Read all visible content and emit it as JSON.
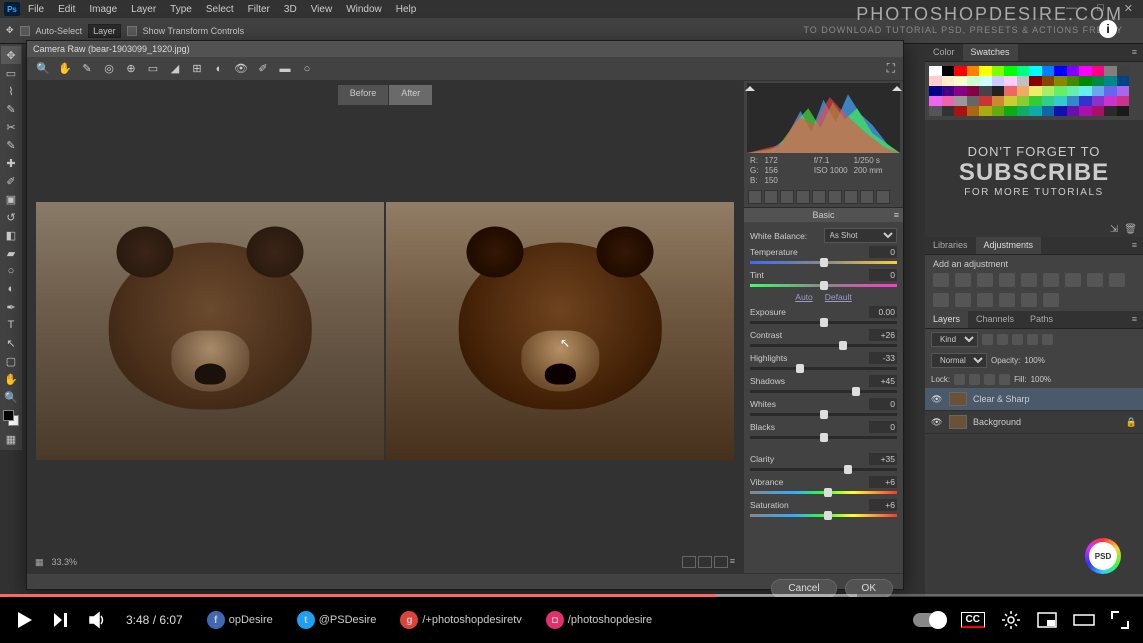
{
  "menu": [
    "File",
    "Edit",
    "Image",
    "Layer",
    "Type",
    "Select",
    "Filter",
    "3D",
    "View",
    "Window",
    "Help"
  ],
  "options": {
    "autoSelect": "Auto-Select",
    "layer": "Layer",
    "showTransform": "Show Transform Controls"
  },
  "watermark": {
    "line1": "PHOTOSHOPDESIRE.COM",
    "line2": "TO DOWNLOAD TUTORIAL PSD, PRESETS & ACTIONS FREELY"
  },
  "cr": {
    "title": "Camera Raw (bear-1903099_1920.jpg)",
    "tabs": {
      "before": "Before",
      "after": "After"
    },
    "zoom": "33.3%",
    "readout": {
      "r": "172",
      "g": "156",
      "b": "150",
      "fstop": "f/7.1",
      "shutter": "1/250 s",
      "iso": "ISO 1000",
      "lens": "200 mm"
    },
    "panel": "Basic",
    "wb": {
      "label": "White Balance:",
      "value": "As Shot"
    },
    "auto": "Auto",
    "default": "Default",
    "sliders": {
      "temperature": {
        "label": "Temperature",
        "value": "0",
        "pos": 50
      },
      "tint": {
        "label": "Tint",
        "value": "0",
        "pos": 50
      },
      "exposure": {
        "label": "Exposure",
        "value": "0.00",
        "pos": 50
      },
      "contrast": {
        "label": "Contrast",
        "value": "+26",
        "pos": 63
      },
      "highlights": {
        "label": "Highlights",
        "value": "-33",
        "pos": 34
      },
      "shadows": {
        "label": "Shadows",
        "value": "+45",
        "pos": 72
      },
      "whites": {
        "label": "Whites",
        "value": "0",
        "pos": 50
      },
      "blacks": {
        "label": "Blacks",
        "value": "0",
        "pos": 50
      },
      "clarity": {
        "label": "Clarity",
        "value": "+35",
        "pos": 67
      },
      "vibrance": {
        "label": "Vibrance",
        "value": "+6",
        "pos": 53
      },
      "saturation": {
        "label": "Saturation",
        "value": "+6",
        "pos": 53
      }
    },
    "buttons": {
      "cancel": "Cancel",
      "ok": "OK"
    }
  },
  "panels": {
    "color": "Color",
    "swatches": "Swatches",
    "libraries": "Libraries",
    "adjustments": "Adjustments",
    "addAdj": "Add an adjustment",
    "layers": "Layers",
    "channels": "Channels",
    "paths": "Paths",
    "kind": "Kind",
    "normal": "Normal",
    "opacity": "Opacity:",
    "opVal": "100%",
    "lock": "Lock:",
    "fill": "Fill:",
    "fillVal": "100%",
    "layer1": "Clear & Sharp",
    "layer2": "Background"
  },
  "subscribe": {
    "l1": "DON'T FORGET TO",
    "l2": "SUBSCRIBE",
    "l3": "FOR MORE TUTORIALS"
  },
  "yt": {
    "time": "3:48 / 6:07",
    "social": [
      {
        "handle": "opDesire",
        "bg": "#4267b2",
        "glyph": "f"
      },
      {
        "handle": "@PSDesire",
        "bg": "#1da1f2",
        "glyph": "t"
      },
      {
        "handle": "/+photoshopdesiretv",
        "bg": "#db4437",
        "glyph": "g"
      },
      {
        "handle": "/photoshopdesire",
        "bg": "#e1306c",
        "glyph": "◘"
      }
    ],
    "cc": "CC"
  },
  "swatchColors": [
    "#fff",
    "#000",
    "#f00",
    "#ff8000",
    "#ff0",
    "#80ff00",
    "#0f0",
    "#00ff80",
    "#0ff",
    "#0080ff",
    "#00f",
    "#8000ff",
    "#f0f",
    "#ff0080",
    "#808080",
    "#404040",
    "#fcc",
    "#fec",
    "#ffc",
    "#cfc",
    "#cff",
    "#ccf",
    "#fcf",
    "#c0c0c0",
    "#800",
    "#840",
    "#880",
    "#480",
    "#080",
    "#084",
    "#088",
    "#048",
    "#008",
    "#408",
    "#808",
    "#804",
    "#444",
    "#222",
    "#e66",
    "#ea6",
    "#ee6",
    "#ae6",
    "#6e6",
    "#6ea",
    "#6ee",
    "#6ae",
    "#66e",
    "#a6e",
    "#e6e",
    "#e6a",
    "#999",
    "#666",
    "#c33",
    "#c83",
    "#cc3",
    "#8c3",
    "#3c3",
    "#3c8",
    "#3cc",
    "#38c",
    "#33c",
    "#83c",
    "#c3c",
    "#c38",
    "#555",
    "#333",
    "#a11",
    "#a61",
    "#aa1",
    "#6a1",
    "#1a1",
    "#1a6",
    "#1aa",
    "#16a",
    "#11a",
    "#61a",
    "#a1a",
    "#a16",
    "#2a2a2a",
    "#1a1a1a"
  ]
}
